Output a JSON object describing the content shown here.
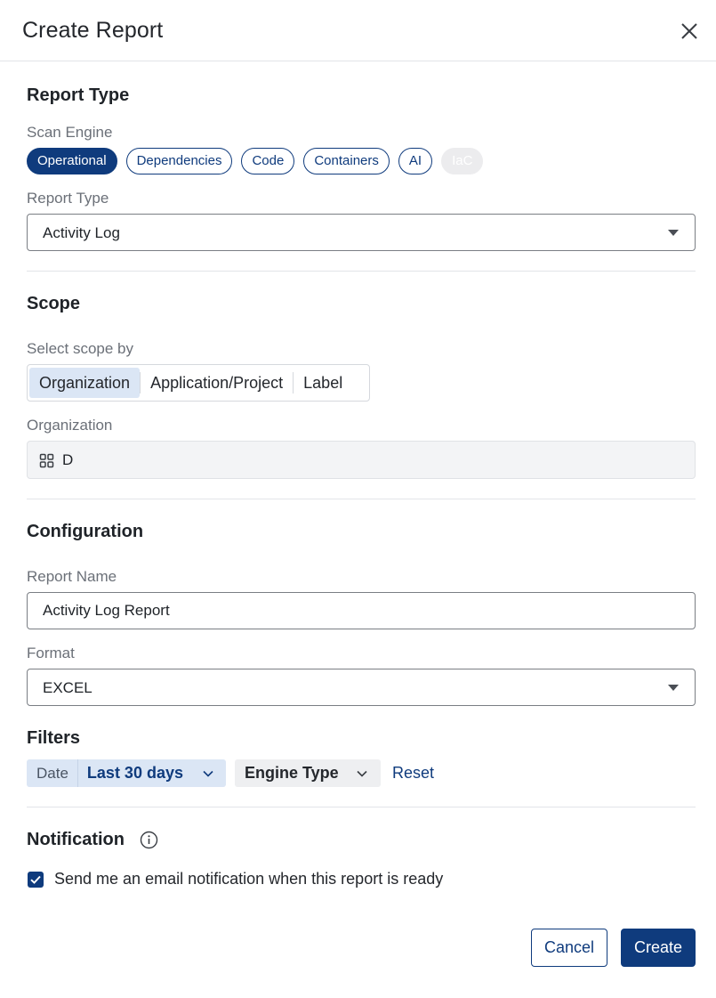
{
  "modal": {
    "title": "Create Report"
  },
  "report_type_section": {
    "title": "Report Type",
    "scan_engine_label": "Scan Engine",
    "engines": [
      {
        "label": "Operational",
        "state": "selected"
      },
      {
        "label": "Dependencies",
        "state": "default"
      },
      {
        "label": "Code",
        "state": "default"
      },
      {
        "label": "Containers",
        "state": "default"
      },
      {
        "label": "AI",
        "state": "default"
      },
      {
        "label": "IaC",
        "state": "disabled"
      }
    ],
    "report_type_label": "Report Type",
    "report_type_value": "Activity Log"
  },
  "scope_section": {
    "title": "Scope",
    "select_by_label": "Select scope by",
    "options": [
      "Organization",
      "Application/Project",
      "Label"
    ],
    "selected_option": "Organization",
    "organization_label": "Organization",
    "organization_value": "D"
  },
  "configuration_section": {
    "title": "Configuration",
    "report_name_label": "Report Name",
    "report_name_value": "Activity Log Report",
    "format_label": "Format",
    "format_value": "EXCEL"
  },
  "filters_section": {
    "title": "Filters",
    "date_label": "Date",
    "date_value": "Last 30 days",
    "engine_type_label": "Engine Type",
    "reset_label": "Reset"
  },
  "notification_section": {
    "title": "Notification",
    "checkbox_label": "Send me an email notification when this report is ready",
    "checkbox_checked": true
  },
  "actions": {
    "cancel_label": "Cancel",
    "create_label": "Create"
  },
  "colors": {
    "primary": "#0f3b7d",
    "selected_segment_bg": "#dbe6f5",
    "muted_label": "#6b7078",
    "readonly_bg": "#f3f4f6"
  },
  "icons": [
    "close-icon",
    "caret-down-icon",
    "organization-icon",
    "chevron-down-icon",
    "info-icon",
    "checkmark-icon"
  ]
}
